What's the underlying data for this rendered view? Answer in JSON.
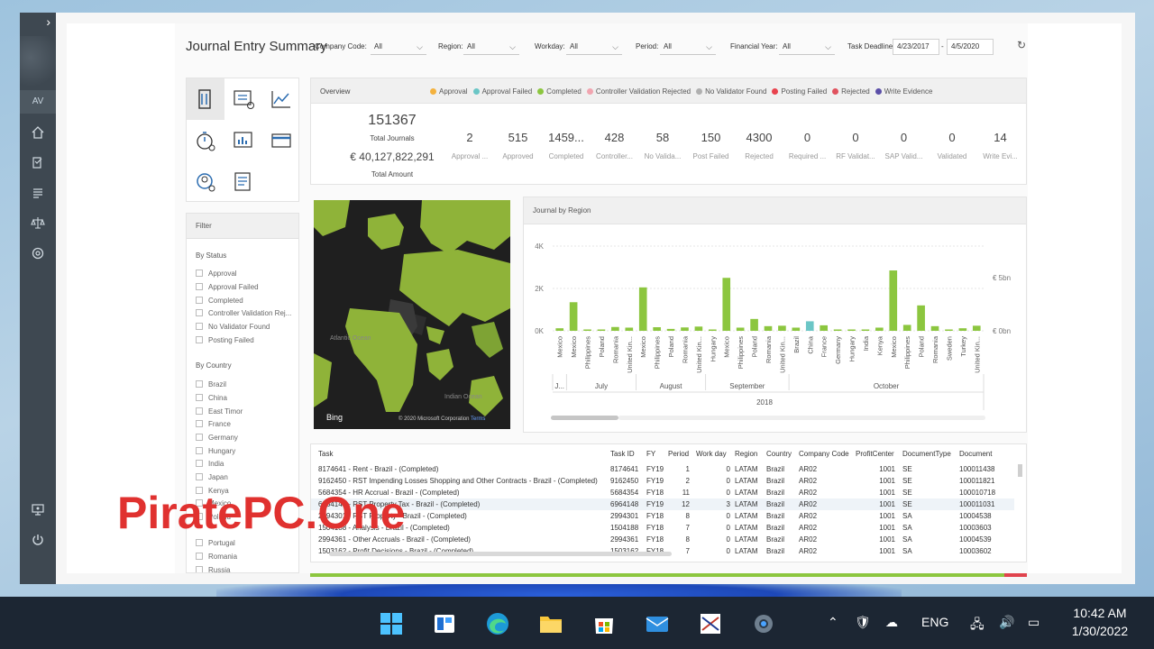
{
  "report": {
    "title": "Journal Entry Summary",
    "filters": [
      {
        "label": "Company Code:",
        "value": "All"
      },
      {
        "label": "Region:",
        "value": "All"
      },
      {
        "label": "Workday:",
        "value": "All"
      },
      {
        "label": "Period:",
        "value": "All"
      },
      {
        "label": "Financial Year:",
        "value": "All"
      }
    ],
    "deadline_label": "Task Deadline:",
    "deadline_from": "4/23/2017",
    "deadline_sep": "-",
    "deadline_to": "4/5/2020"
  },
  "sidebar": {
    "user_initials": "AV"
  },
  "overview": {
    "title": "Overview",
    "legend": [
      {
        "label": "Approval",
        "color": "#f4b23e"
      },
      {
        "label": "Approval Failed",
        "color": "#6bc6c6"
      },
      {
        "label": "Completed",
        "color": "#8cc63f"
      },
      {
        "label": "Controller Validation Rejected",
        "color": "#f1a5b0"
      },
      {
        "label": "No Validator Found",
        "color": "#b0b0b0"
      },
      {
        "label": "Posting Failed",
        "color": "#e8434e"
      },
      {
        "label": "Rejected",
        "color": "#e0525e"
      },
      {
        "label": "Write Evidence",
        "color": "#5b4fa8"
      }
    ],
    "total_journals": "151367",
    "total_journals_label": "Total Journals",
    "total_amount": "€ 40,127,822,291",
    "total_amount_label": "Total Amount",
    "kpis": [
      {
        "value": "2",
        "label": "Approval ..."
      },
      {
        "value": "515",
        "label": "Approved"
      },
      {
        "value": "1459...",
        "label": "Completed"
      },
      {
        "value": "428",
        "label": "Controller..."
      },
      {
        "value": "58",
        "label": "No Valida..."
      },
      {
        "value": "150",
        "label": "Post Failed"
      },
      {
        "value": "4300",
        "label": "Rejected"
      },
      {
        "value": "0",
        "label": "Required ..."
      },
      {
        "value": "0",
        "label": "RF Validat..."
      },
      {
        "value": "0",
        "label": "SAP Valid..."
      },
      {
        "value": "0",
        "label": "Validated"
      },
      {
        "value": "14",
        "label": "Write Evi..."
      }
    ]
  },
  "map": {
    "provider": "Bing",
    "copyright": "© 2020 Microsoft Corporation",
    "terms": "Terms",
    "labels": [
      "Atlantic Ocean",
      "Indian Ocean"
    ]
  },
  "filter_panel": {
    "title": "Filter",
    "status_title": "By Status",
    "statuses": [
      "Approval",
      "Approval Failed",
      "Completed",
      "Controller Validation Rej...",
      "No Validator Found",
      "Posting Failed"
    ],
    "country_title": "By Country",
    "countries": [
      "Brazil",
      "China",
      "East Timor",
      "France",
      "Germany",
      "Hungary",
      "India",
      "Japan",
      "Kenya",
      "Mexico",
      "Poland",
      "Portugal",
      "Romania",
      "Russia"
    ]
  },
  "chart_data": {
    "type": "bar",
    "title": "Journal by Region",
    "y_ticks": [
      "4K",
      "2K",
      "0K"
    ],
    "y2_ticks": [
      "€ 5bn",
      "€ 0bn"
    ],
    "ylim": [
      0,
      4000
    ],
    "categories": [
      "Mexico",
      "Mexico",
      "Philippines",
      "Poland",
      "Romania",
      "United Kin...",
      "Mexico",
      "Philippines",
      "Poland",
      "Romania",
      "United Kin...",
      "Hungary",
      "Mexico",
      "Philippines",
      "Poland",
      "Romania",
      "United Kin...",
      "Brazil",
      "China",
      "France",
      "Germany",
      "Hungary",
      "India",
      "Kenya",
      "Mexico",
      "Philippines",
      "Poland",
      "Romania",
      "Sweden",
      "Turkey",
      "United Kin..."
    ],
    "values": [
      120,
      1350,
      40,
      40,
      180,
      150,
      2050,
      170,
      90,
      160,
      200,
      40,
      2500,
      150,
      560,
      220,
      240,
      150,
      450,
      260,
      40,
      40,
      20,
      150,
      2850,
      280,
      1200,
      220,
      20,
      120,
      240
    ],
    "highlight_color": "#8cc63f",
    "secondary_color": "#6bc6c6",
    "months": [
      {
        "label": "J...",
        "count": 1
      },
      {
        "label": "July",
        "count": 5
      },
      {
        "label": "August",
        "count": 5
      },
      {
        "label": "September",
        "count": 6
      },
      {
        "label": "October",
        "count": 14
      }
    ],
    "year": "2018"
  },
  "table": {
    "columns": [
      "Task",
      "Task ID",
      "FY",
      "Period",
      "Work day",
      "Region",
      "Country",
      "Company Code",
      "ProfitCenter",
      "DocumentType",
      "Document"
    ],
    "rows": [
      [
        "8174641 - Rent - Brazil - (Completed)",
        "8174641",
        "FY19",
        "1",
        "0",
        "LATAM",
        "Brazil",
        "AR02",
        "1001",
        "SE",
        "100011438"
      ],
      [
        "9162450 - RST Impending Losses Shopping and Other Contracts - Brazil - (Completed)",
        "9162450",
        "FY19",
        "2",
        "0",
        "LATAM",
        "Brazil",
        "AR02",
        "1001",
        "SE",
        "100011821"
      ],
      [
        "5684354 - HR Accrual - Brazil - (Completed)",
        "5684354",
        "FY18",
        "11",
        "0",
        "LATAM",
        "Brazil",
        "AR02",
        "1001",
        "SE",
        "100010718"
      ],
      [
        "6964148 - RST Property Tax - Brazil - (Completed)",
        "6964148",
        "FY19",
        "12",
        "3",
        "LATAM",
        "Brazil",
        "AR02",
        "1001",
        "SE",
        "100011031"
      ],
      [
        "2994301 - RST Property - Brazil - (Completed)",
        "2994301",
        "FY18",
        "8",
        "0",
        "LATAM",
        "Brazil",
        "AR02",
        "1001",
        "SA",
        "10004538"
      ],
      [
        "1504188 - Analysis - Brazil - (Completed)",
        "1504188",
        "FY18",
        "7",
        "0",
        "LATAM",
        "Brazil",
        "AR02",
        "1001",
        "SA",
        "10003603"
      ],
      [
        "2994361 - Other Accruals - Brazil - (Completed)",
        "2994361",
        "FY18",
        "8",
        "0",
        "LATAM",
        "Brazil",
        "AR02",
        "1001",
        "SA",
        "10004539"
      ],
      [
        "1503162 - Profit Decisions - Brazil - (Completed)",
        "1503162",
        "FY18",
        "7",
        "0",
        "LATAM",
        "Brazil",
        "AR02",
        "1001",
        "SA",
        "10003602"
      ]
    ]
  },
  "watermark": "PiratePC.One",
  "taskbar": {
    "language": "ENG",
    "time": "10:42 AM",
    "date": "1/30/2022"
  }
}
